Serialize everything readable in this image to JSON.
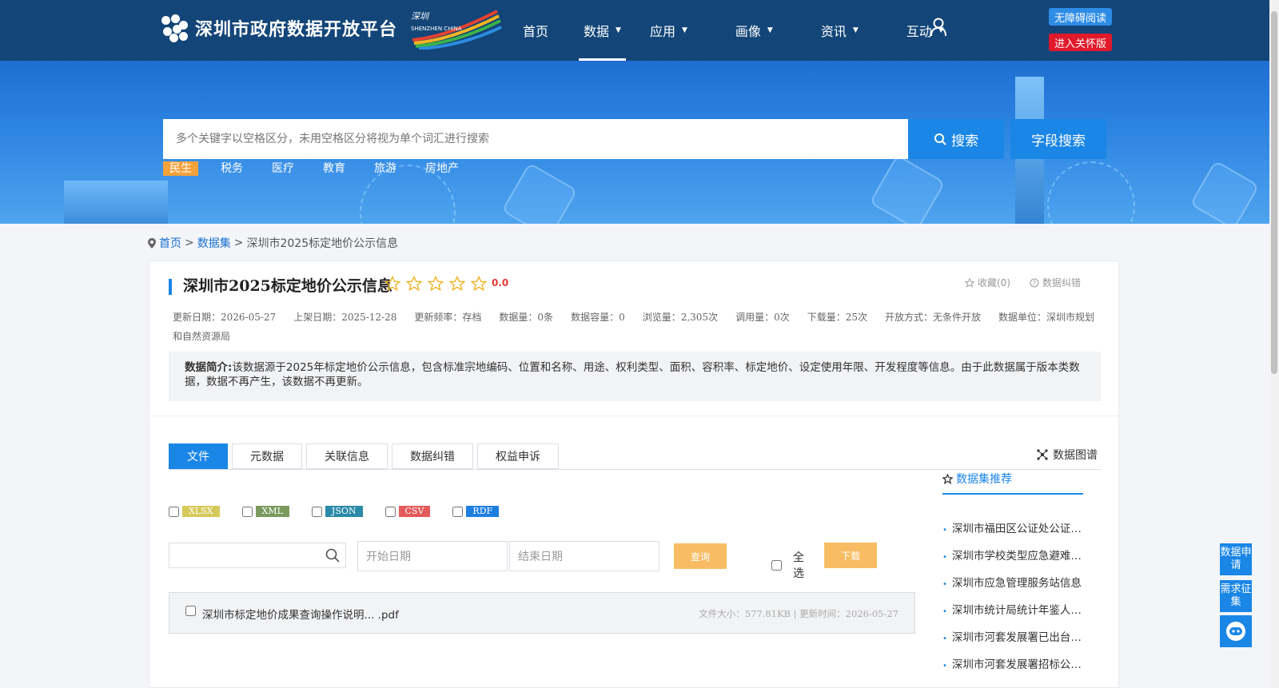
{
  "header": {
    "site_title": "深圳市政府数据开放平台",
    "badge_text": "深圳 SHENZHEN CHINA",
    "nav": [
      {
        "label": "首页"
      },
      {
        "label": "数据"
      },
      {
        "label": "应用"
      },
      {
        "label": "画像"
      },
      {
        "label": "资讯"
      },
      {
        "label": "互动"
      }
    ],
    "accessibility_label": "无障碍阅读",
    "care_label": "进入关怀版"
  },
  "search": {
    "placeholder": "多个关键字以空格区分，未用空格区分将视为单个词汇进行搜索",
    "search_label": "搜索",
    "field_search_label": "字段搜索",
    "hot_tags": [
      "民生",
      "税务",
      "医疗",
      "教育",
      "旅游",
      "房地产"
    ]
  },
  "breadcrumb": {
    "home": "首页",
    "sep1": ">",
    "datasets": "数据集",
    "sep2": ">",
    "current": "深圳市2025标定地价公示信息"
  },
  "dataset": {
    "title": "深圳市2025标定地价公示信息",
    "score": "0.0",
    "rating_stars": 0,
    "favorite": "收藏(0)",
    "error_report": "数据纠错",
    "meta": {
      "update_date": "更新日期：2026-05-27",
      "listed_date": "上架日期：2025-12-28",
      "frequency": "更新频率：存档",
      "count": "数据量：0条",
      "capacity": "数据容量：0",
      "views": "浏览量：2,305次",
      "calls": "调用量：0次",
      "downloads": "下载量：25次",
      "open_mode": "开放方式：无条件开放",
      "source": "数据单位：深圳市规划和自然资源局"
    },
    "intro_label": "数据简介:",
    "intro_text": "该数据源于2025年标定地价公示信息，包含标准宗地编码、位置和名称、用途、权利类型、面积、容积率、标定地价、设定使用年限、开发程度等信息。由于此数据属于版本类数据，数据不再产生，该数据不再更新。"
  },
  "tabs": [
    "文件",
    "元数据",
    "关联信息",
    "数据纠错",
    "权益申诉"
  ],
  "graph_link": "数据图谱",
  "formats": [
    {
      "label": "XLSX",
      "color": "#d6c95a"
    },
    {
      "label": "XML",
      "color": "#7a9a5e"
    },
    {
      "label": "JSON",
      "color": "#2a8aa8"
    },
    {
      "label": "CSV",
      "color": "#e55a5a"
    },
    {
      "label": "RDF",
      "color": "#1f7fe0"
    }
  ],
  "filter": {
    "start_date": "开始日期",
    "end_date": "结束日期",
    "query_label": "查询",
    "select_all": "全选",
    "download_label": "下载"
  },
  "files": [
    {
      "name": "深圳市标定地价成果查询操作说明... .pdf",
      "info": "文件大小：577.81KB | 更新时间：2026-05-27"
    }
  ],
  "recommend": {
    "title": "数据集推荐",
    "items": [
      "深圳市福田区公证处公证员信息",
      "深圳市学校类型应急避难场所",
      "深圳市应急管理服务站信息",
      "深圳市统计局统计年鉴人口数据",
      "深圳市河套发展署已出台政策",
      "深圳市河套发展署招标公告信息"
    ]
  },
  "floating": {
    "apply": "数据申请",
    "need": "需求征集"
  },
  "colors": {
    "header_bg": "#134578",
    "accent": "#1a86e6",
    "button_orange": "#f8bd64",
    "score_red": "#e53935"
  }
}
